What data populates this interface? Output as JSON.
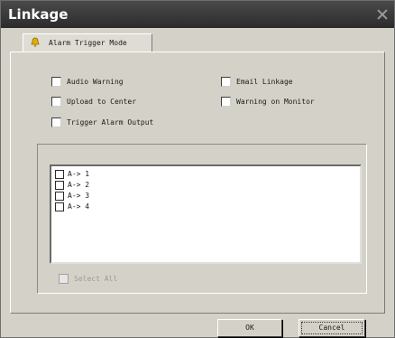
{
  "window": {
    "title": "Linkage"
  },
  "tab": {
    "label": "Alarm Trigger Mode",
    "icon": "bell-icon"
  },
  "options": [
    {
      "label": "Audio Warning",
      "checked": false
    },
    {
      "label": "Email Linkage",
      "checked": false
    },
    {
      "label": "Upload to Center",
      "checked": false
    },
    {
      "label": "Warning on Monitor",
      "checked": false
    },
    {
      "label": "Trigger Alarm Output",
      "checked": false
    }
  ],
  "outputs": [
    {
      "label": "A-> 1",
      "checked": false
    },
    {
      "label": "A-> 2",
      "checked": false
    },
    {
      "label": "A-> 3",
      "checked": false
    },
    {
      "label": "A-> 4",
      "checked": false
    }
  ],
  "select_all": {
    "label": "Select All",
    "enabled": false,
    "checked": false
  },
  "buttons": {
    "ok": "OK",
    "cancel": "Cancel"
  },
  "colors": {
    "titlebar": "#2b2b2b",
    "dialog": "#d4d2c8",
    "icon": "#e0b000"
  }
}
